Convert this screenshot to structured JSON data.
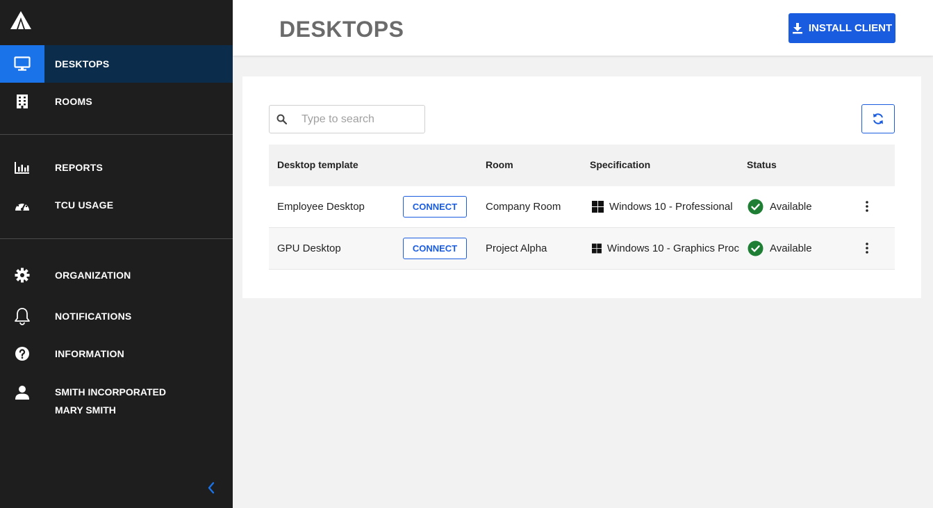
{
  "sidebar": {
    "items": [
      {
        "label": "DESKTOPS",
        "icon": "monitor-icon"
      },
      {
        "label": "ROOMS",
        "icon": "building-icon"
      },
      {
        "label": "REPORTS",
        "icon": "bar-chart-icon"
      },
      {
        "label": "TCU USAGE",
        "icon": "speedometer-icon"
      },
      {
        "label": "ORGANIZATION",
        "icon": "gear-icon"
      },
      {
        "label": "NOTIFICATIONS",
        "icon": "bell-icon"
      },
      {
        "label": "INFORMATION",
        "icon": "question-icon"
      }
    ],
    "user": {
      "org": "SMITH INCORPORATED",
      "name": "MARY SMITH",
      "icon": "user-icon"
    },
    "accent": "#1a73e8"
  },
  "header": {
    "title": "DESKTOPS",
    "install_label": "INSTALL CLIENT"
  },
  "search": {
    "placeholder": "Type to search"
  },
  "table": {
    "headers": {
      "template": "Desktop template",
      "room": "Room",
      "spec": "Specification",
      "status": "Status"
    },
    "rows": [
      {
        "template": "Employee Desktop",
        "connect": "CONNECT",
        "room": "Company Room",
        "spec": "Windows 10 - Professional",
        "status": "Available"
      },
      {
        "template": "GPU Desktop",
        "connect": "CONNECT",
        "room": "Project Alpha",
        "spec": "Windows 10 - Graphics Proc",
        "status": "Available"
      }
    ]
  },
  "colors": {
    "primary": "#1a5ce0",
    "success": "#1e7e34",
    "sidebar_bg": "#1e1e1e"
  }
}
